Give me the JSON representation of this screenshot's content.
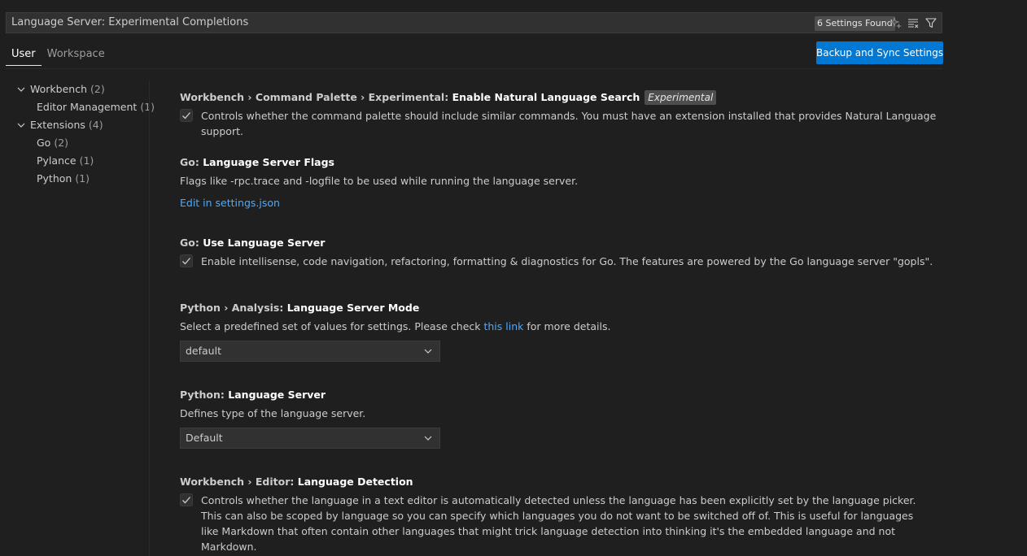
{
  "search": {
    "value": "Language Server: Experimental Completions",
    "count_label": "6 Settings Found",
    "action_icons": [
      "sparkle-icon",
      "clear-filter-icon",
      "filter-icon"
    ]
  },
  "tabs": [
    {
      "label": "User",
      "active": true
    },
    {
      "label": "Workspace",
      "active": false
    }
  ],
  "sync_button": {
    "label": "Backup and Sync Settings"
  },
  "toc": [
    {
      "label": "Workbench",
      "count": "(2)"
    },
    {
      "label": "Editor Management",
      "count": "(1)"
    },
    {
      "label": "Extensions",
      "count": "(4)"
    },
    {
      "label": "Go",
      "count": "(2)"
    },
    {
      "label": "Pylance",
      "count": "(1)"
    },
    {
      "label": "Python",
      "count": "(1)"
    }
  ],
  "settings": [
    {
      "category": "Workbench › Command Palette › Experimental: ",
      "label": "Enable Natural Language Search",
      "tag": "Experimental",
      "description": "Controls whether the command palette should include similar commands. You must have an extension installed that provides Natural Language support.",
      "checked": true
    },
    {
      "category": "Go: ",
      "label": "Language Server Flags",
      "description": "Flags like -rpc.trace and -logfile to be used while running the language server.",
      "link": "Edit in settings.json"
    },
    {
      "category": "Go: ",
      "label": "Use Language Server",
      "description": "Enable intellisense, code navigation, refactoring, formatting & diagnostics for Go. The features are powered by the Go language server \"gopls\".",
      "checked": true
    },
    {
      "category": "Python › Analysis: ",
      "label": "Language Server Mode",
      "description_before": "Select a predefined set of values for settings. Please check ",
      "description_link": "this link",
      "description_after": " for more details.",
      "select_value": "default"
    },
    {
      "category": "Python: ",
      "label": "Language Server",
      "description": "Defines type of the language server.",
      "select_value": "Default"
    },
    {
      "category": "Workbench › Editor: ",
      "label": "Language Detection",
      "description": "Controls whether the language in a text editor is automatically detected unless the language has been explicitly set by the language picker. This can also be scoped by language so you can specify which languages you do not want to be switched off of. This is useful for languages like Markdown that often contain other languages that might trick language detection into thinking it's the embedded language and not Markdown.",
      "checked": true
    }
  ],
  "colors": {
    "background": "#1f1f1f",
    "accent": "#0078d4",
    "link": "#4daafc"
  }
}
